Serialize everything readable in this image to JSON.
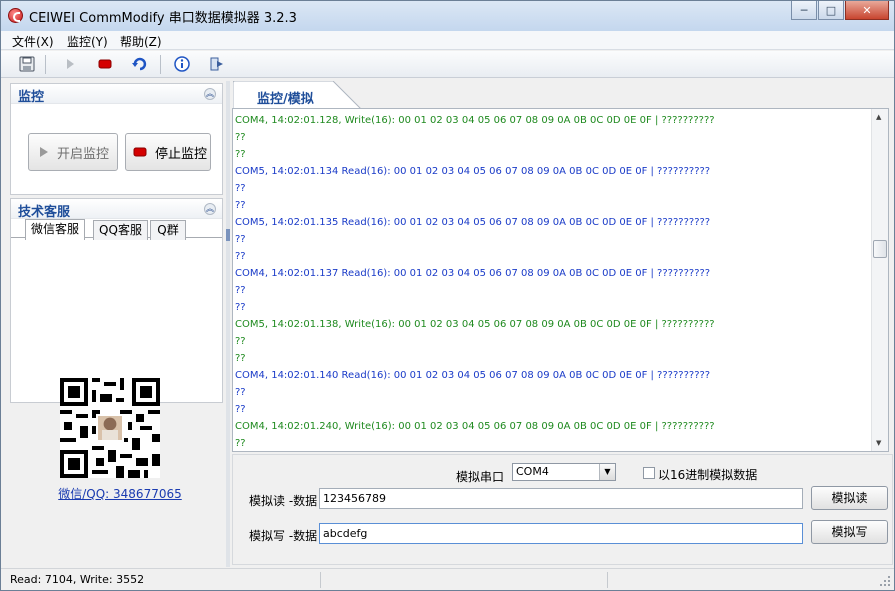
{
  "window": {
    "title": "CEIWEI CommModify 串口数据模拟器 3.2.3",
    "controls": [
      "─",
      "□",
      "✕"
    ]
  },
  "menu": [
    "文件(X)",
    "监控(Y)",
    "帮助(Z)"
  ],
  "toolbar": {
    "icons": [
      "save-icon",
      "play-icon",
      "stop-icon",
      "refresh-icon",
      "info-icon",
      "exit-icon"
    ]
  },
  "monitor_panel": {
    "title": "监控",
    "start_label": "开启监控",
    "stop_label": "停止监控"
  },
  "support_panel": {
    "title": "技术客服",
    "tabs": [
      "微信客服",
      "QQ客服",
      "Q群"
    ],
    "link_text": "微信/QQ:  348677065"
  },
  "log_tab": {
    "label": "监控/模拟"
  },
  "log_lines": [
    {
      "text": "COM4, 14:02:01.128, Write(16): 00 01 02 03 04 05 06 07 08 09 0A 0B 0C 0D 0E 0F | ??????????",
      "color": "green"
    },
    {
      "text": "??",
      "color": "green"
    },
    {
      "text": "??",
      "color": "green"
    },
    {
      "text": "COM5, 14:02:01.134 Read(16): 00 01 02 03 04 05 06 07 08 09 0A 0B 0C 0D 0E 0F | ??????????",
      "color": "blue"
    },
    {
      "text": "??",
      "color": "blue"
    },
    {
      "text": "??",
      "color": "blue"
    },
    {
      "text": "COM5, 14:02:01.135 Read(16): 00 01 02 03 04 05 06 07 08 09 0A 0B 0C 0D 0E 0F | ??????????",
      "color": "blue"
    },
    {
      "text": "??",
      "color": "blue"
    },
    {
      "text": "??",
      "color": "blue"
    },
    {
      "text": "COM4, 14:02:01.137 Read(16): 00 01 02 03 04 05 06 07 08 09 0A 0B 0C 0D 0E 0F | ??????????",
      "color": "blue"
    },
    {
      "text": "??",
      "color": "blue"
    },
    {
      "text": "??",
      "color": "blue"
    },
    {
      "text": "COM5, 14:02:01.138, Write(16): 00 01 02 03 04 05 06 07 08 09 0A 0B 0C 0D 0E 0F | ??????????",
      "color": "green"
    },
    {
      "text": "??",
      "color": "green"
    },
    {
      "text": "??",
      "color": "green"
    },
    {
      "text": "COM4, 14:02:01.140 Read(16): 00 01 02 03 04 05 06 07 08 09 0A 0B 0C 0D 0E 0F | ??????????",
      "color": "blue"
    },
    {
      "text": "??",
      "color": "blue"
    },
    {
      "text": "??",
      "color": "blue"
    },
    {
      "text": "COM4, 14:02:01.240, Write(16): 00 01 02 03 04 05 06 07 08 09 0A 0B 0C 0D 0E 0F | ??????????",
      "color": "green"
    },
    {
      "text": "??",
      "color": "green"
    }
  ],
  "simulate": {
    "port_label": "模拟串口",
    "port_value": "COM4",
    "hex_checkbox_label": "以16进制模拟数据",
    "read_label": "模拟读 -数据",
    "read_value": "123456789",
    "read_button": "模拟读",
    "write_label": "模拟写 -数据",
    "write_value": "abcdefg",
    "write_button": "模拟写"
  },
  "status": {
    "text": "Read: 7104, Write: 3552"
  },
  "colors": {
    "write_line": "#1f8a1f",
    "read_line": "#1a3bc8",
    "panel_title": "#1f4e9a",
    "stop_indicator": "#d40000"
  }
}
